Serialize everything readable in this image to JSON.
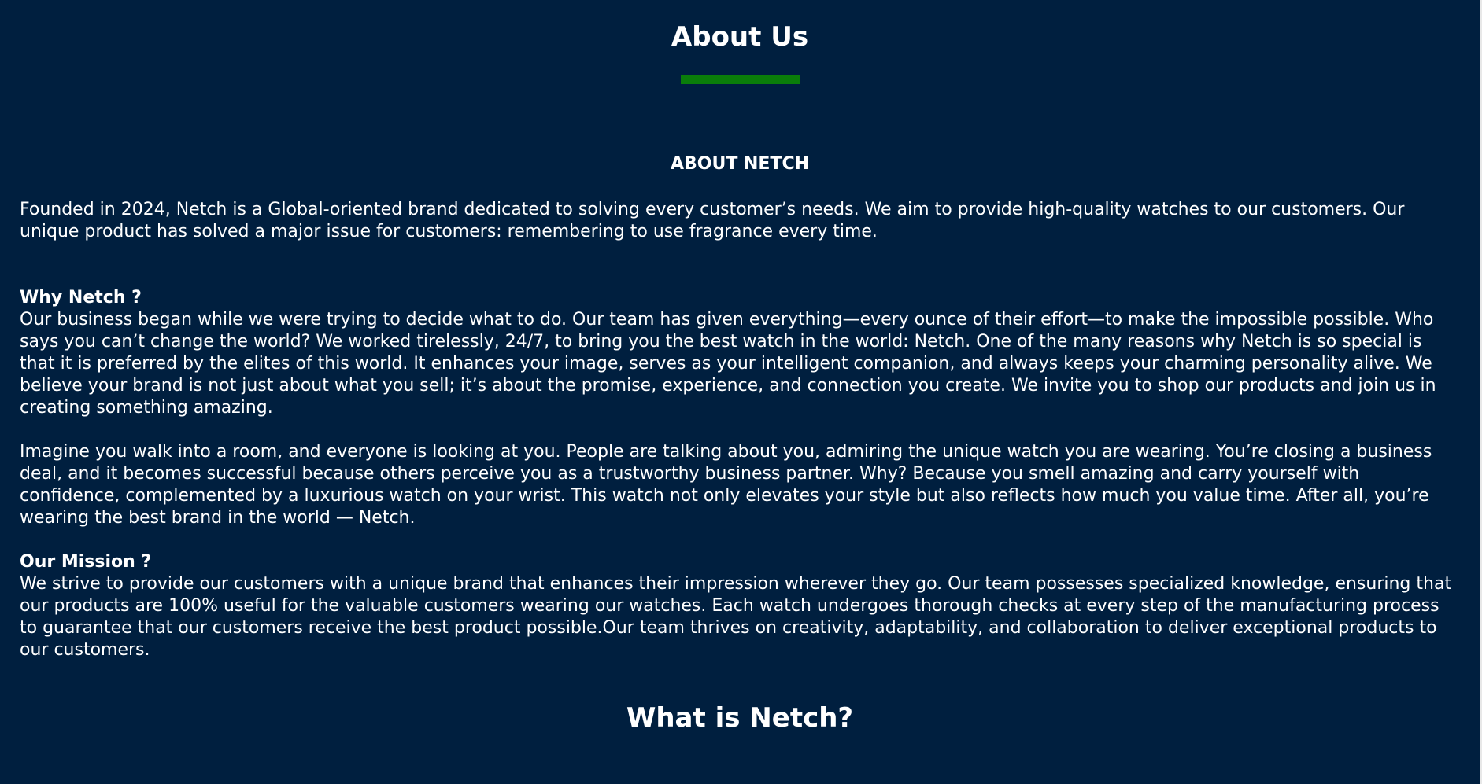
{
  "about": {
    "title": "About Us",
    "accent_color": "#0a7d0a",
    "section_title": "ABOUT NETCH",
    "intro": "Founded in 2024, Netch is a Global-oriented brand dedicated to solving every customer’s needs. We aim to provide high-quality watches to our customers. Our unique product has solved a major issue for customers: remembering to use fragrance every time."
  },
  "why": {
    "title": "Why Netch ?",
    "paragraph1": "Our business began while we were trying to decide what to do. Our team has given everything—every ounce of their effort—to make the impossible possible. Who says you can’t change the world? We worked tirelessly, 24/7, to bring you the best watch in the world: Netch. One of the many reasons why Netch is so special is that it is preferred by the elites of this world. It enhances your image, serves as your intelligent companion, and always keeps your charming personality alive. We believe your brand is not just about what you sell; it’s about the promise, experience, and connection you create. We invite you to shop our products and join us in creating something amazing.",
    "paragraph2": "Imagine you walk into a room, and everyone is looking at you. People are talking about you, admiring the unique watch you are wearing. You’re closing a business deal, and it becomes successful because others perceive you as a trustworthy business partner. Why? Because you smell amazing and carry yourself with confidence, complemented by a luxurious watch on your wrist. This watch not only elevates your style but also reflects how much you value time. After all, you’re wearing the best brand in the world — Netch."
  },
  "mission": {
    "title": "Our Mission ?",
    "paragraph": "We strive to provide our customers with a unique brand that enhances their impression wherever they go. Our team possesses specialized knowledge, ensuring that our products are 100% useful for the valuable customers wearing our watches. Each watch undergoes thorough checks at every step of the manufacturing process to guarantee that our customers receive the best product possible.Our team thrives on creativity, adaptability, and collaboration to deliver exceptional products to our customers."
  },
  "what": {
    "title": "What is Netch?"
  },
  "colors": {
    "background": "#001f3f",
    "text": "#ffffff"
  }
}
